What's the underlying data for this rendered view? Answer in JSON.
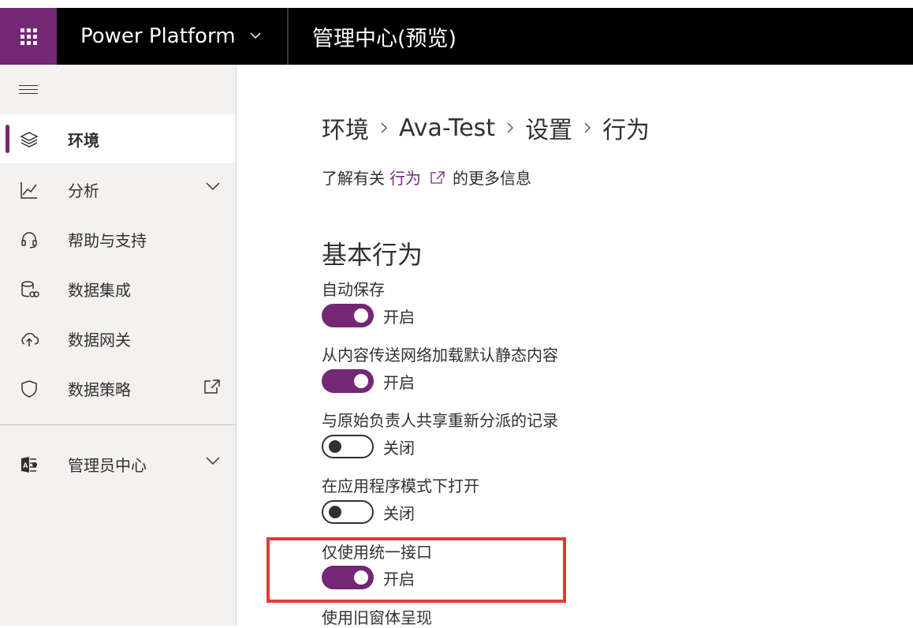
{
  "header": {
    "app_name": "Power Platform",
    "page_title": "管理中心(预览)"
  },
  "sidebar": {
    "items": [
      {
        "label": "环境",
        "icon": "layers-icon",
        "selected": true
      },
      {
        "label": "分析",
        "icon": "chart-line-icon",
        "expandable": true
      },
      {
        "label": "帮助与支持",
        "icon": "headset-icon"
      },
      {
        "label": "数据集成",
        "icon": "database-link-icon"
      },
      {
        "label": "数据网关",
        "icon": "cloud-upload-icon"
      },
      {
        "label": "数据策略",
        "icon": "shield-icon",
        "external": true
      },
      {
        "label": "管理员中心",
        "icon": "admin-center-icon",
        "expandable": true
      }
    ]
  },
  "breadcrumb": [
    "环境",
    "Ava-Test",
    "设置",
    "行为"
  ],
  "learn_more": {
    "prefix": "了解有关",
    "link": "行为",
    "suffix": "的更多信息"
  },
  "section_title": "基本行为",
  "settings": [
    {
      "label": "自动保存",
      "state": "开启",
      "on": true
    },
    {
      "label": "从内容传送网络加载默认静态内容",
      "state": "开启",
      "on": true
    },
    {
      "label": "与原始负责人共享重新分派的记录",
      "state": "关闭",
      "on": false
    },
    {
      "label": "在应用程序模式下打开",
      "state": "关闭",
      "on": false
    },
    {
      "label": "仅使用统一接口",
      "state": "开启",
      "on": true
    },
    {
      "label": "使用旧窗体呈现"
    }
  ],
  "colors": {
    "accent": "#742774",
    "highlight": "#e53935",
    "topbar": "#000000",
    "sidebar_bg": "#f3f2f1"
  }
}
